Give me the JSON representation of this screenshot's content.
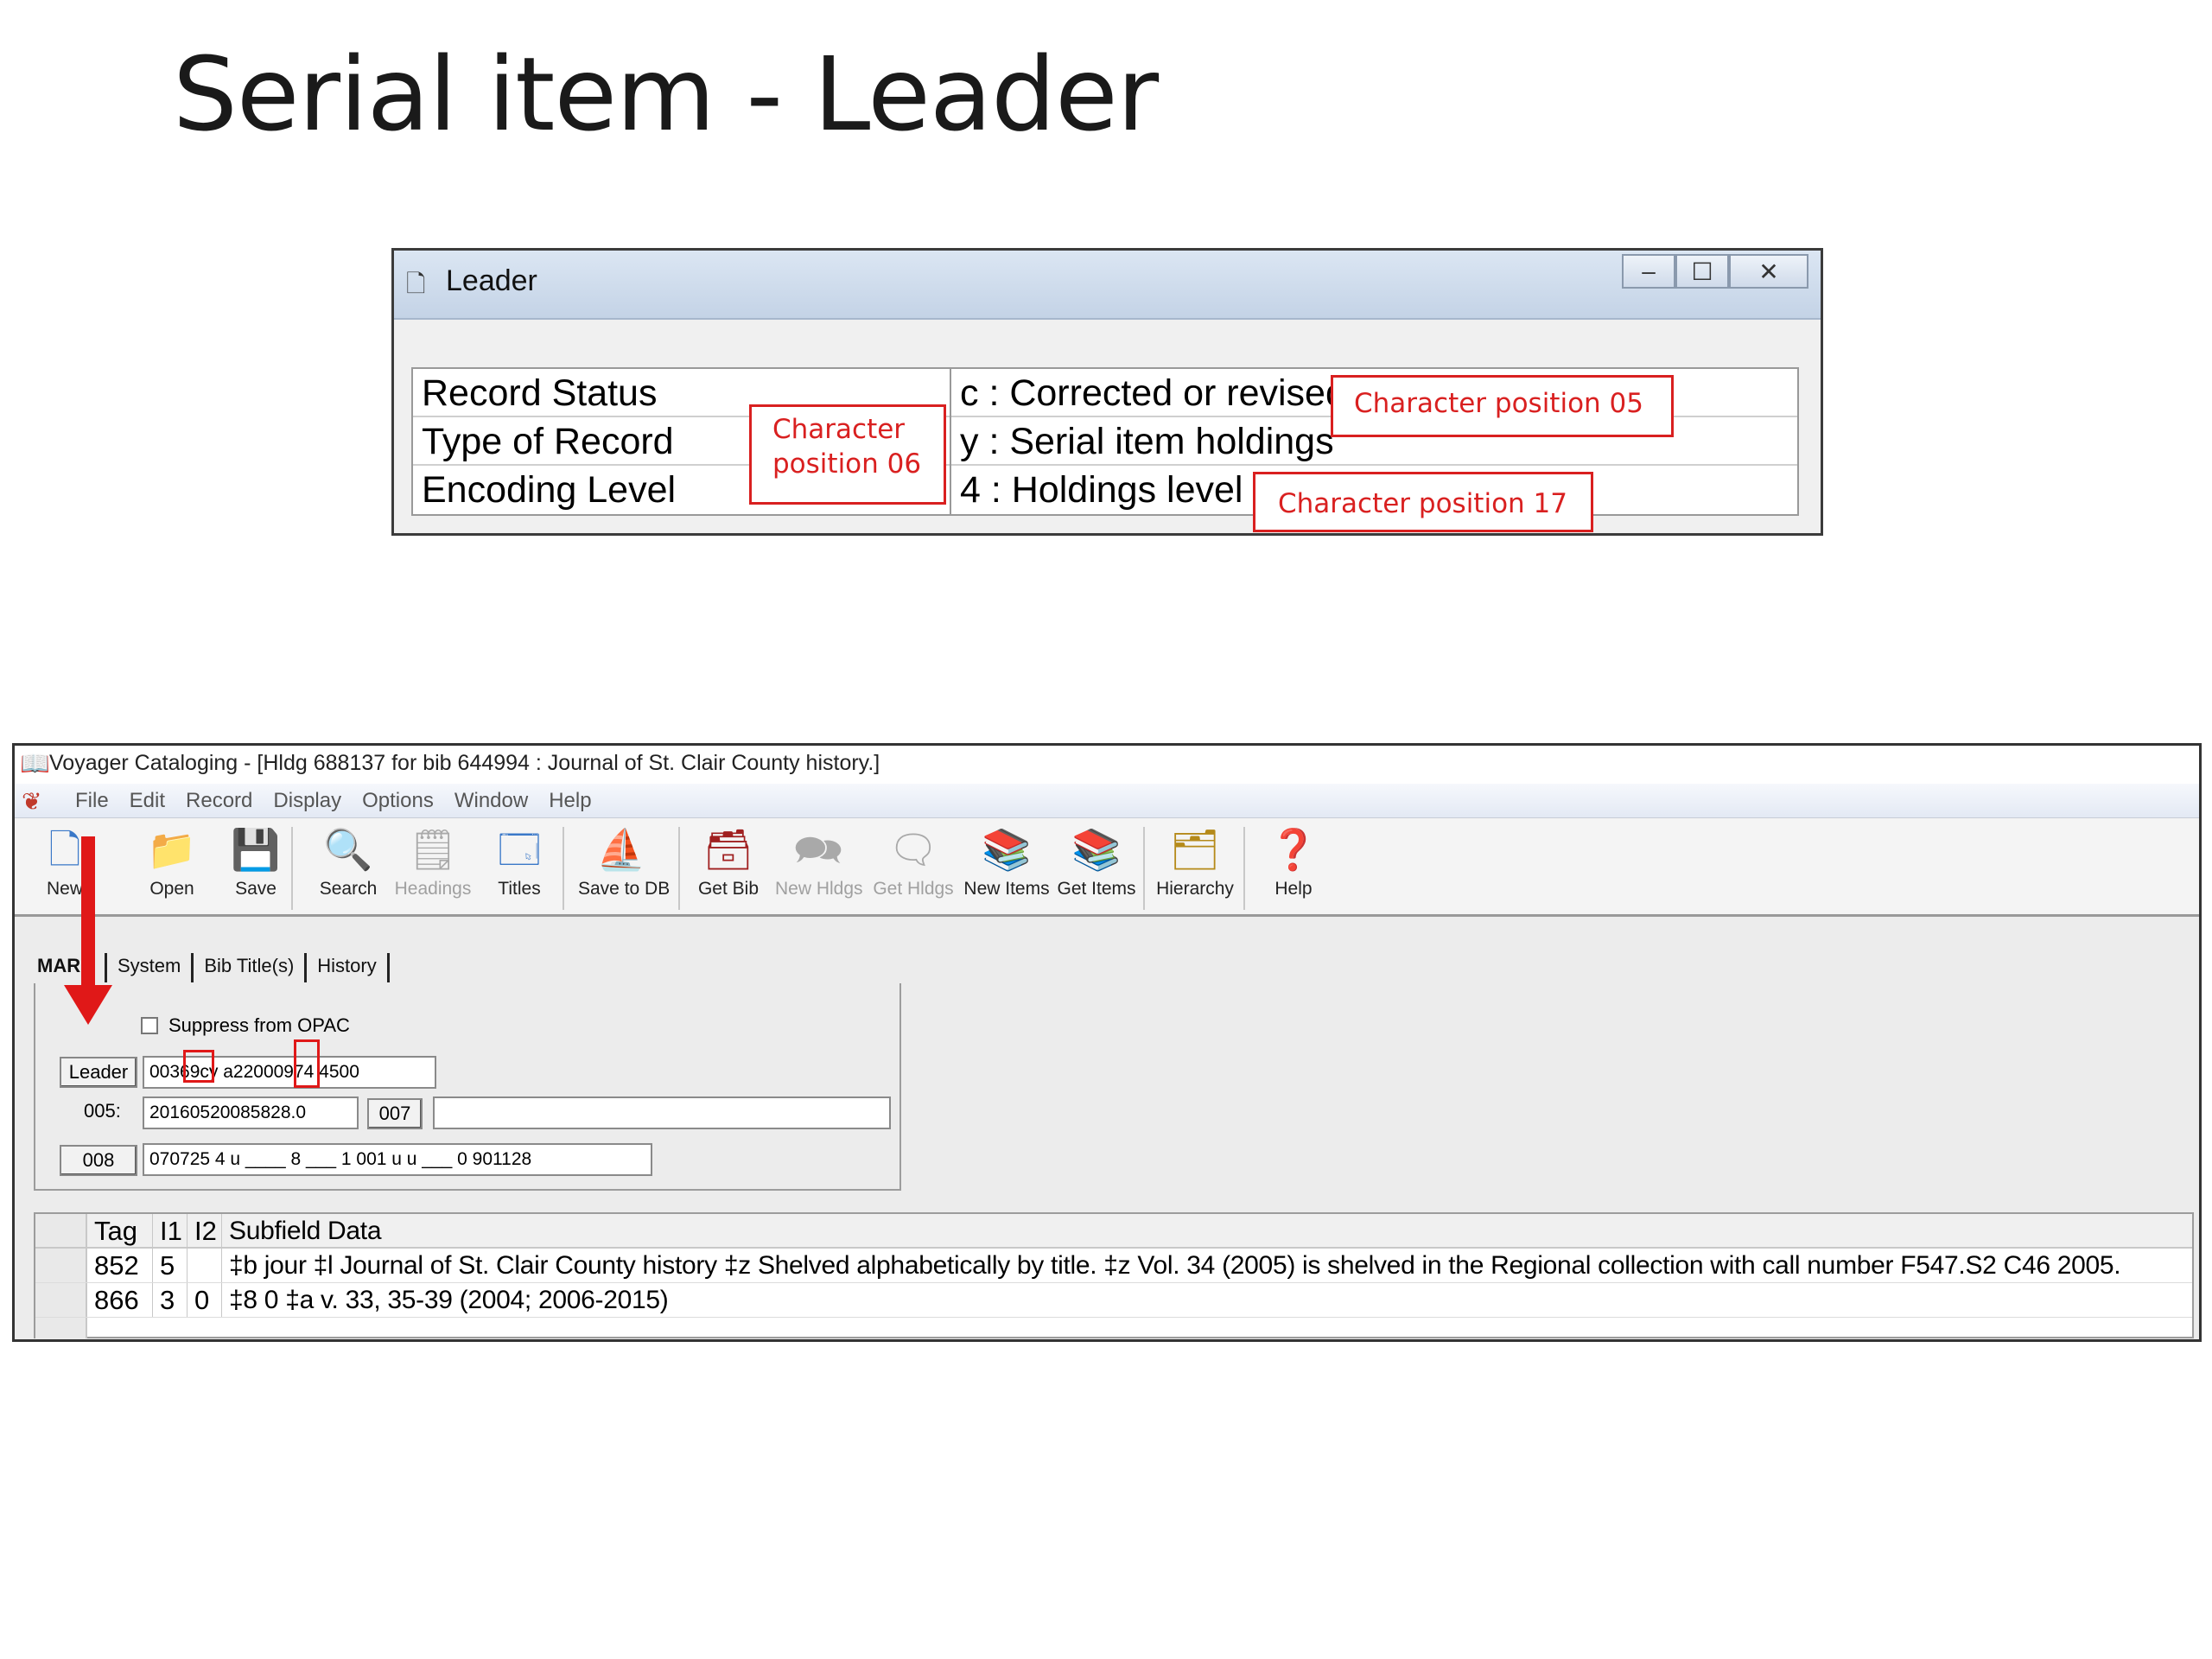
{
  "slide": {
    "title": "Serial item - Leader"
  },
  "leader_dialog": {
    "icon": "document-icon",
    "title": "Leader",
    "rows": [
      {
        "label": "Record Status",
        "value": "c : Corrected or revised"
      },
      {
        "label": "Type of Record",
        "value": "y : Serial item holdings"
      },
      {
        "label": "Encoding Level",
        "value": "4 : Holdings level 4"
      }
    ],
    "annotations": {
      "pos05": "Character position 05",
      "pos06_line1": "Character",
      "pos06_line2": "position 06",
      "pos17": "Character position 17"
    }
  },
  "voyager": {
    "title": "Voyager Cataloging - [Hldg 688137 for bib 644994 : Journal of St. Clair County history.]",
    "menu": [
      "File",
      "Edit",
      "Record",
      "Display",
      "Options",
      "Window",
      "Help"
    ],
    "toolbar": [
      {
        "label": "New",
        "icon": "new-document-icon",
        "enabled": true
      },
      {
        "label": "Open",
        "icon": "folder-icon",
        "enabled": true
      },
      {
        "label": "Save",
        "icon": "floppy-disk-icon",
        "enabled": true
      },
      {
        "label": "Search",
        "icon": "magnifier-icon",
        "enabled": true
      },
      {
        "label": "Headings",
        "icon": "headings-icon",
        "enabled": false
      },
      {
        "label": "Titles",
        "icon": "titles-icon",
        "enabled": true
      },
      {
        "label": "Save to DB",
        "icon": "sailboat-icon",
        "enabled": true
      },
      {
        "label": "Get Bib",
        "icon": "get-bib-icon",
        "enabled": true
      },
      {
        "label": "New Hldgs",
        "icon": "new-holdings-icon",
        "enabled": false
      },
      {
        "label": "Get Hldgs",
        "icon": "get-holdings-icon",
        "enabled": false
      },
      {
        "label": "New Items",
        "icon": "new-items-icon",
        "enabled": true
      },
      {
        "label": "Get Items",
        "icon": "get-items-icon",
        "enabled": true
      },
      {
        "label": "Hierarchy",
        "icon": "hierarchy-icon",
        "enabled": true
      },
      {
        "label": "Help",
        "icon": "help-icon",
        "enabled": true
      }
    ],
    "tabs": [
      "MARC",
      "System",
      "Bib Title(s)",
      "History"
    ],
    "suppress_label": "Suppress from OPAC",
    "leader_button": "Leader",
    "leader_value": "00369cy  a22000974  4500",
    "field005_label": "005:",
    "field005_value": "20160520085828.0",
    "field007_button": "007",
    "field007_value": "",
    "field008_button": "008",
    "field008_value": "070725  4  u  ____  8  ___  1  001  u  u  ___  0  901128",
    "grid": {
      "headers": {
        "tag": "Tag",
        "i1": "I1",
        "i2": "I2",
        "sub": "Subfield Data"
      },
      "rows": [
        {
          "tag": "852",
          "i1": "5",
          "i2": "",
          "sub": "‡b jour ‡l Journal of St. Clair County history ‡z Shelved alphabetically by title. ‡z Vol. 34 (2005) is shelved in the Regional collection with call number F547.S2 C46 2005."
        },
        {
          "tag": "866",
          "i1": "3",
          "i2": "0",
          "sub": "‡8 0 ‡a v. 33, 35-39 (2004; 2006-2015)"
        }
      ]
    },
    "colors": {
      "annotation_red": "#d92020",
      "arrow_red": "#e01818"
    }
  }
}
